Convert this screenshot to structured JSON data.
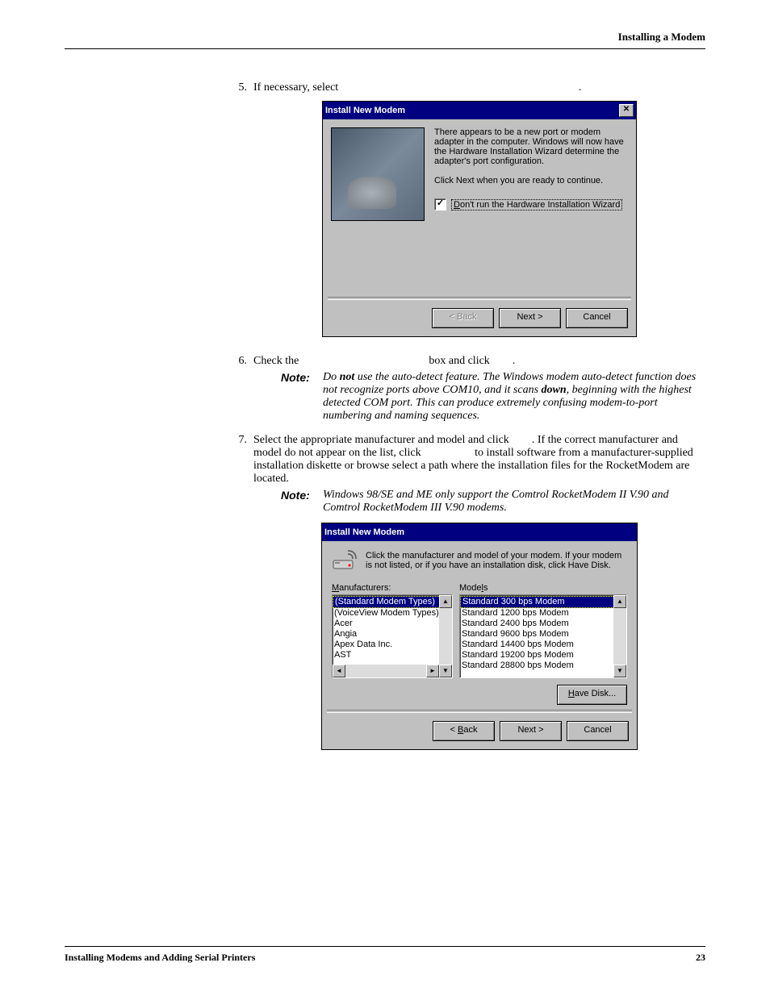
{
  "header": {
    "section": "Installing a Modem"
  },
  "steps": {
    "s5": {
      "num": "5.",
      "text": "If necessary, select",
      "trail": "."
    },
    "s6": {
      "num": "6.",
      "pre": "Check the",
      "mid": "box and click",
      "trail": "."
    },
    "s7": {
      "num": "7.",
      "text_a": "Select the appropriate manufacturer and model and click",
      "text_b": ". If the correct manufacturer and model do not appear on the list, click",
      "text_c": "to install software from a manufacturer-supplied installation diskette or browse select a path where the installation files for the RocketModem are located."
    }
  },
  "notes": {
    "label": "Note:",
    "n1_a": "Do ",
    "n1_b": "not",
    "n1_c": " use the auto-detect feature. The Windows modem auto-detect function does not recognize ports above COM10, and it scans ",
    "n1_d": "down",
    "n1_e": ", beginning with the highest detected COM port. This can produce extremely confusing modem-to-port numbering and naming sequences.",
    "n2": "Windows 98/SE and ME only support the Comtrol RocketModem II V.90 and Comtrol RocketModem III V.90 modems."
  },
  "dlg1": {
    "title": "Install New Modem",
    "close": "✕",
    "text1": "There appears to be a new port or modem adapter in the computer. Windows will now have the Hardware Installation Wizard determine the adapter's port configuration.",
    "text2": "Click Next when you are ready to continue.",
    "chk_mark": "✓",
    "chk_label_u": "D",
    "chk_label_rest": "on't run the Hardware Installation Wizard",
    "btn_back": "< Back",
    "btn_next": "Next >",
    "btn_cancel": "Cancel"
  },
  "dlg2": {
    "title": "Install New Modem",
    "instr": "Click the manufacturer and model of your modem. If your modem is not listed, or if you have an installation disk, click Have Disk.",
    "manu_label_u": "M",
    "manu_label_rest": "anufacturers:",
    "model_label_pre": "Mode",
    "model_label_u": "l",
    "model_label_post": "s",
    "manufacturers": [
      "(Standard Modem Types)",
      "(VoiceView Modem Types)",
      "Acer",
      "Angia",
      "Apex Data Inc.",
      "AST"
    ],
    "models": [
      "Standard   300 bps Modem",
      "Standard  1200 bps Modem",
      "Standard  2400 bps Modem",
      "Standard  9600 bps Modem",
      "Standard 14400 bps Modem",
      "Standard 19200 bps Modem",
      "Standard 28800 bps Modem"
    ],
    "btn_have_u": "H",
    "btn_have_rest": "ave Disk...",
    "btn_back_u": "B",
    "btn_back_pre": "< ",
    "btn_back_post": "ack",
    "btn_next": "Next >",
    "btn_cancel": "Cancel"
  },
  "footer": {
    "left": "Installing Modems and Adding Serial Printers",
    "right": "23"
  }
}
